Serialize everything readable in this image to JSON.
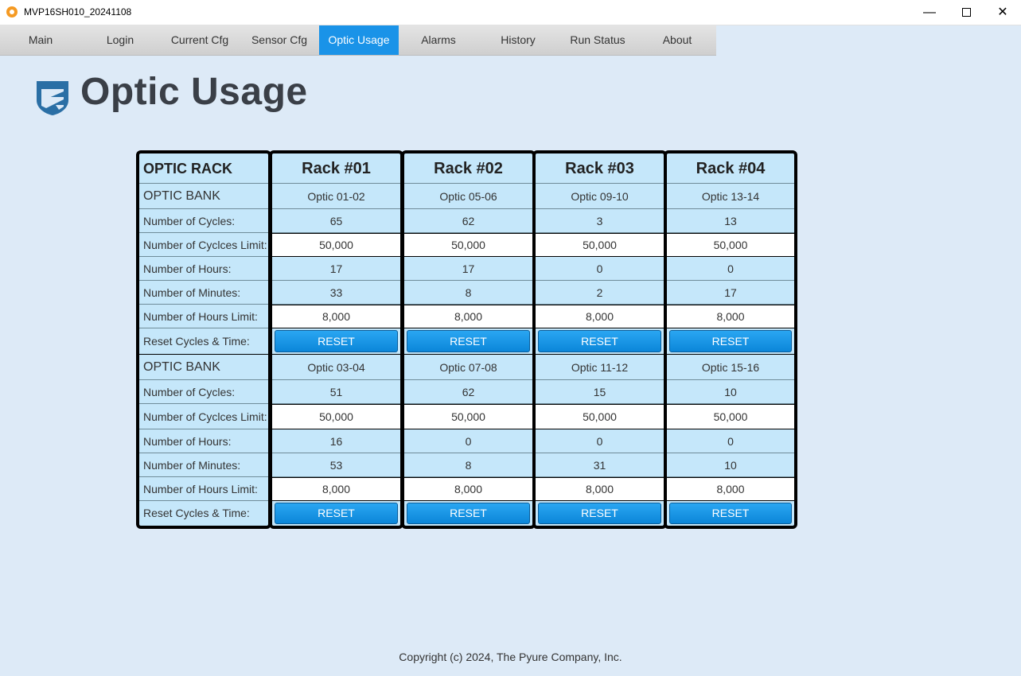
{
  "window": {
    "title": "MVP16SH010_20241108",
    "minimize_icon": "minimize-icon",
    "maximize_icon": "maximize-icon",
    "close_icon": "close-icon"
  },
  "tabs": [
    {
      "label": "Main"
    },
    {
      "label": "Login"
    },
    {
      "label": "Current Cfg"
    },
    {
      "label": "Sensor Cfg"
    },
    {
      "label": "Optic Usage",
      "active": true
    },
    {
      "label": "Alarms"
    },
    {
      "label": "History"
    },
    {
      "label": "Run Status"
    },
    {
      "label": "About"
    }
  ],
  "page": {
    "title": "Optic Usage",
    "logo": "shield-logo",
    "accent_color": "#1a93e8"
  },
  "labels": {
    "rack": "OPTIC RACK",
    "bank": "OPTIC BANK",
    "cycles": "Number of Cycles:",
    "cycles_limit": "Number of Cyclces Limit:",
    "hours": "Number of Hours:",
    "minutes": "Number of Minutes:",
    "hours_limit": "Number of Hours Limit:",
    "reset": "Reset Cycles & Time:"
  },
  "reset_label": "RESET",
  "racks": [
    {
      "name": "Rack #01",
      "banks": [
        {
          "optic": "Optic 01-02",
          "cycles": "65",
          "cycles_limit": "50,000",
          "hours": "17",
          "minutes": "33",
          "hours_limit": "8,000"
        },
        {
          "optic": "Optic 03-04",
          "cycles": "51",
          "cycles_limit": "50,000",
          "hours": "16",
          "minutes": "53",
          "hours_limit": "8,000"
        }
      ]
    },
    {
      "name": "Rack #02",
      "banks": [
        {
          "optic": "Optic 05-06",
          "cycles": "62",
          "cycles_limit": "50,000",
          "hours": "17",
          "minutes": "8",
          "hours_limit": "8,000"
        },
        {
          "optic": "Optic 07-08",
          "cycles": "62",
          "cycles_limit": "50,000",
          "hours": "0",
          "minutes": "8",
          "hours_limit": "8,000"
        }
      ]
    },
    {
      "name": "Rack #03",
      "banks": [
        {
          "optic": "Optic 09-10",
          "cycles": "3",
          "cycles_limit": "50,000",
          "hours": "0",
          "minutes": "2",
          "hours_limit": "8,000"
        },
        {
          "optic": "Optic 11-12",
          "cycles": "15",
          "cycles_limit": "50,000",
          "hours": "0",
          "minutes": "31",
          "hours_limit": "8,000"
        }
      ]
    },
    {
      "name": "Rack #04",
      "banks": [
        {
          "optic": "Optic 13-14",
          "cycles": "13",
          "cycles_limit": "50,000",
          "hours": "0",
          "minutes": "17",
          "hours_limit": "8,000"
        },
        {
          "optic": "Optic 15-16",
          "cycles": "10",
          "cycles_limit": "50,000",
          "hours": "0",
          "minutes": "10",
          "hours_limit": "8,000"
        }
      ]
    }
  ],
  "footer": {
    "copyright": "Copyright (c) 2024, The Pyure Company, Inc."
  }
}
